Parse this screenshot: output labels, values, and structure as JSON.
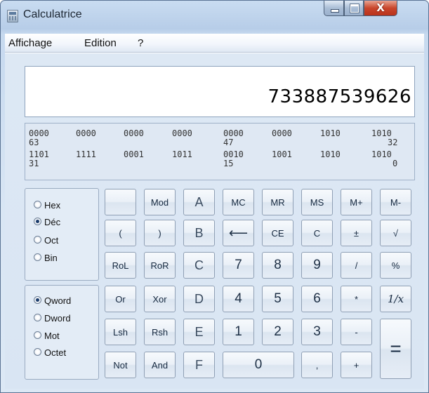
{
  "window": {
    "title": "Calculatrice",
    "close_glyph": "X"
  },
  "menu": [
    "Affichage",
    "Edition",
    "?"
  ],
  "display": {
    "value": "733887539626"
  },
  "bits": {
    "row1": {
      "groups": [
        "0000",
        "0000",
        "0000",
        "0000",
        "0000",
        "0000",
        "1010",
        "1010"
      ],
      "idx_left": "63",
      "idx_mid": "47",
      "idx_right": "32"
    },
    "row2": {
      "groups": [
        "1101",
        "1111",
        "0001",
        "1011",
        "0010",
        "1001",
        "1010",
        "1010"
      ],
      "idx_left": "31",
      "idx_mid": "15",
      "idx_right": "0"
    }
  },
  "base": {
    "options": [
      "Hex",
      "Déc",
      "Oct",
      "Bin"
    ],
    "selected": "Déc"
  },
  "word": {
    "options": [
      "Qword",
      "Dword",
      "Mot",
      "Octet"
    ],
    "selected": "Qword"
  },
  "keys": {
    "r1": [
      "",
      "Mod",
      "A",
      "MC",
      "MR",
      "MS",
      "M+",
      "M-"
    ],
    "r2": [
      "(",
      ")",
      "B",
      "⟵",
      "CE",
      "C",
      "±",
      "√"
    ],
    "r3": [
      "RoL",
      "RoR",
      "C",
      "7",
      "8",
      "9",
      "/",
      "%"
    ],
    "r4": [
      "Or",
      "Xor",
      "D",
      "4",
      "5",
      "6",
      "*",
      "1/x"
    ],
    "r5": [
      "Lsh",
      "Rsh",
      "E",
      "1",
      "2",
      "3",
      "-",
      "="
    ],
    "r6": [
      "Not",
      "And",
      "F",
      "0",
      ",",
      "+"
    ]
  }
}
